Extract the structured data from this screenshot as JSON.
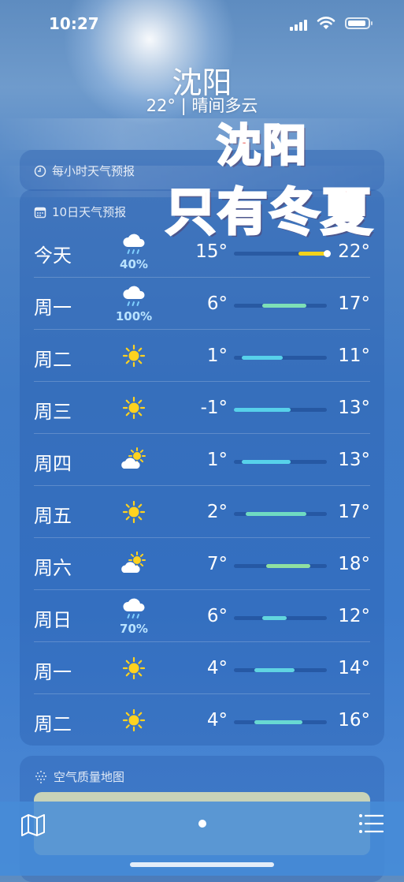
{
  "status_bar": {
    "time": "10:27"
  },
  "location": {
    "city": "沈阳",
    "summary": "22°  |  晴间多云"
  },
  "overlay": {
    "line1": "沈阳",
    "line2": "只有冬夏"
  },
  "hourly_card": {
    "title": "每小时天气预报",
    "icon": "clock-icon"
  },
  "forecast_card": {
    "title": "10日天气预报",
    "icon": "calendar-icon",
    "range_min": -1,
    "range_max": 22,
    "days": [
      {
        "day": "今天",
        "icon": "cloud-rain-icon",
        "pop": "40%",
        "low": "15°",
        "high": "22°",
        "low_val": 15,
        "high_val": 22,
        "current": 22,
        "bar_color": "#f2d21b"
      },
      {
        "day": "周一",
        "icon": "cloud-rain-icon",
        "pop": "100%",
        "low": "6°",
        "high": "17°",
        "low_val": 6,
        "high_val": 17,
        "bar_color": "#7ee0b6"
      },
      {
        "day": "周二",
        "icon": "sun-icon",
        "pop": "",
        "low": "1°",
        "high": "11°",
        "low_val": 1,
        "high_val": 11,
        "bar_color": "#57d1ea"
      },
      {
        "day": "周三",
        "icon": "sun-icon",
        "pop": "",
        "low": "-1°",
        "high": "13°",
        "low_val": -1,
        "high_val": 13,
        "bar_color": "#57d1ea"
      },
      {
        "day": "周四",
        "icon": "partly-cloudy-icon",
        "pop": "",
        "low": "1°",
        "high": "13°",
        "low_val": 1,
        "high_val": 13,
        "bar_color": "#57d1ea"
      },
      {
        "day": "周五",
        "icon": "sun-icon",
        "pop": "",
        "low": "2°",
        "high": "17°",
        "low_val": 2,
        "high_val": 17,
        "bar_color": "#6fdbc2"
      },
      {
        "day": "周六",
        "icon": "partly-cloudy-icon",
        "pop": "",
        "low": "7°",
        "high": "18°",
        "low_val": 7,
        "high_val": 18,
        "bar_color": "#8fe0a0"
      },
      {
        "day": "周日",
        "icon": "cloud-rain-icon",
        "pop": "70%",
        "low": "6°",
        "high": "12°",
        "low_val": 6,
        "high_val": 12,
        "bar_color": "#62d6de"
      },
      {
        "day": "周一",
        "icon": "sun-icon",
        "pop": "",
        "low": "4°",
        "high": "14°",
        "low_val": 4,
        "high_val": 14,
        "bar_color": "#60d4e2"
      },
      {
        "day": "周二",
        "icon": "sun-icon",
        "pop": "",
        "low": "4°",
        "high": "16°",
        "low_val": 4,
        "high_val": 16,
        "bar_color": "#68d8d2"
      }
    ]
  },
  "air_quality_card": {
    "title": "空气质量地图",
    "icon": "air-quality-icon"
  },
  "tab_bar": {
    "map_icon": "map-icon",
    "list_icon": "list-icon"
  }
}
